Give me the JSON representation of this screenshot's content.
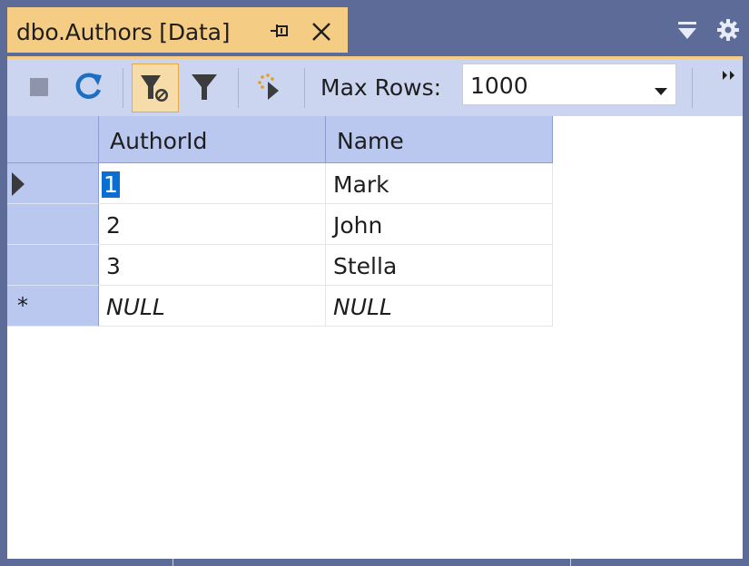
{
  "window": {
    "tab_title": "dbo.Authors [Data]",
    "pin_icon": "pin-icon",
    "close_icon": "close-icon",
    "dropdown_icon": "window-dropdown-icon",
    "gear_icon": "gear-icon"
  },
  "toolbar": {
    "stop_icon": "stop-icon",
    "refresh_icon": "refresh-icon",
    "filter_clear_icon": "filter-clear-icon",
    "filter_icon": "filter-icon",
    "script_icon": "script-icon",
    "max_rows_label": "Max Rows:",
    "max_rows_value": "1000",
    "overflow_icon": "overflow-chevron-icon"
  },
  "grid": {
    "columns": [
      "AuthorId",
      "Name"
    ],
    "rows": [
      {
        "marker": "current",
        "AuthorId": "1",
        "Name": "Mark"
      },
      {
        "marker": "",
        "AuthorId": "2",
        "Name": "John"
      },
      {
        "marker": "",
        "AuthorId": "3",
        "Name": "Stella"
      },
      {
        "marker": "*",
        "AuthorId": "NULL",
        "Name": "NULL"
      }
    ]
  },
  "colors": {
    "chrome": "#5d6b99",
    "tab_active": "#f5cc84",
    "toolbar": "#ccd5f0",
    "header": "#bac7ee",
    "selection": "#0b6fd1"
  }
}
